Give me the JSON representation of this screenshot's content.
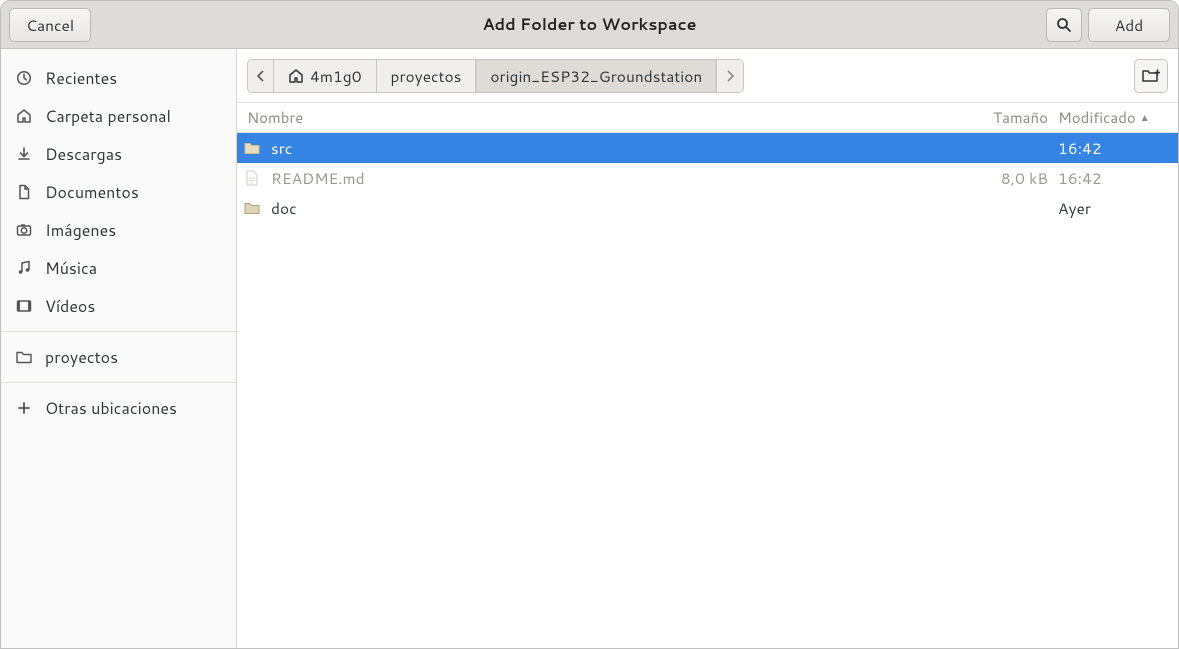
{
  "header": {
    "cancel": "Cancel",
    "title": "Add Folder to Workspace",
    "add": "Add"
  },
  "sidebar": {
    "places": [
      {
        "icon": "clock-icon",
        "label": "Recientes"
      },
      {
        "icon": "home-icon",
        "label": "Carpeta personal"
      },
      {
        "icon": "download-icon",
        "label": "Descargas"
      },
      {
        "icon": "document-icon",
        "label": "Documentos"
      },
      {
        "icon": "camera-icon",
        "label": "Imágenes"
      },
      {
        "icon": "music-icon",
        "label": "Música"
      },
      {
        "icon": "video-icon",
        "label": "Vídeos"
      }
    ],
    "bookmarks": [
      {
        "icon": "folder-icon",
        "label": "proyectos"
      }
    ],
    "other": [
      {
        "icon": "plus-icon",
        "label": "Otras ubicaciones"
      }
    ]
  },
  "pathbar": {
    "segments": [
      {
        "icon": "home-icon",
        "label": "4m1g0"
      },
      {
        "label": "proyectos"
      },
      {
        "label": "origin_ESP32_Groundstation",
        "active": true
      }
    ]
  },
  "columns": {
    "name": "Nombre",
    "size": "Tamaño",
    "modified": "Modificado"
  },
  "rows": [
    {
      "type": "folder",
      "name": "src",
      "size": "",
      "modified": "16:42",
      "selected": true
    },
    {
      "type": "file",
      "name": "README.md",
      "size": "8,0 kB",
      "modified": "16:42",
      "dim": true
    },
    {
      "type": "folder",
      "name": "doc",
      "size": "",
      "modified": "Ayer"
    }
  ]
}
